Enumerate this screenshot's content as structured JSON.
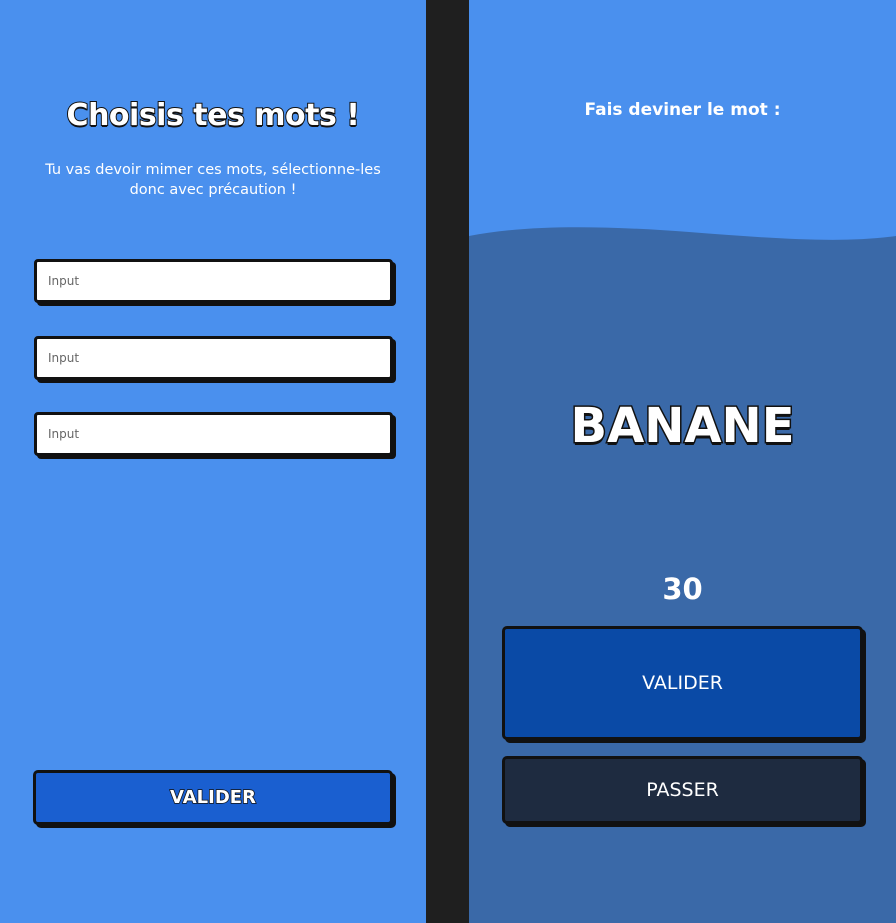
{
  "word_selection": {
    "title": "Choisis tes mots !",
    "subtitle": "Tu vas devoir mimer ces mots, sélectionne-les donc avec précaution !",
    "inputs": [
      {
        "placeholder": "Input",
        "value": ""
      },
      {
        "placeholder": "Input",
        "value": ""
      },
      {
        "placeholder": "Input",
        "value": ""
      }
    ],
    "validate_label": "VALIDER"
  },
  "guess_screen": {
    "prompt": "Fais deviner le mot :",
    "word": "BANANE",
    "timer": "30",
    "validate_label": "VALIDER",
    "skip_label": "PASSER"
  },
  "colors": {
    "primary_blue": "#4a90ee",
    "dark_blue_panel": "#3a69a8",
    "button_blue": "#1a5fd0",
    "validate_blue": "#0a4aa6",
    "skip_navy": "#1e2b40",
    "divider": "#1f1f1f"
  }
}
